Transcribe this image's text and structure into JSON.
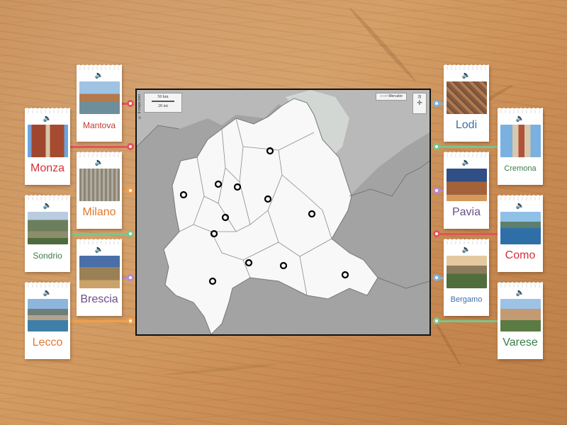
{
  "map": {
    "scale_km": "50 km",
    "scale_mi": "20 mi",
    "credit": "© d-maps.com",
    "projection": "Mercator",
    "north": "N"
  },
  "left_cards": [
    {
      "label": "Mantova",
      "color": "#c0392b",
      "connector": "#e0555a",
      "scene": "river-town"
    },
    {
      "label": "Monza",
      "color": "#d2323a",
      "connector": "#e0555a",
      "scene": "cathedral-square"
    },
    {
      "label": "Milano",
      "color": "#e07a2e",
      "connector": "#f0a04b",
      "scene": "gothic-cathedral"
    },
    {
      "label": "Sondrio",
      "color": "#3a7d48",
      "connector": "#7cc48d",
      "scene": "alpine-valley"
    },
    {
      "label": "Brescia",
      "color": "#6a4f8a",
      "connector": "#b48ad0",
      "scene": "church-domes"
    },
    {
      "label": "Lecco",
      "color": "#e07a2e",
      "connector": "#f0a04b",
      "scene": "lake-town"
    }
  ],
  "right_cards": [
    {
      "label": "Lodi",
      "color": "#3f6fa8",
      "connector": "#7fb2da",
      "scene": "aerial-town"
    },
    {
      "label": "Cremona",
      "color": "#3a7d48",
      "connector": "#7cc48d",
      "scene": "bell-tower"
    },
    {
      "label": "Pavia",
      "color": "#6a4f8a",
      "connector": "#b48ad0",
      "scene": "night-square"
    },
    {
      "label": "Como",
      "color": "#d2323a",
      "connector": "#e0555a",
      "scene": "lake-mountains"
    },
    {
      "label": "Bergamo",
      "color": "#3f6fa8",
      "connector": "#7fb2da",
      "scene": "hill-town"
    },
    {
      "label": "Varese",
      "color": "#3a7d48",
      "connector": "#7cc48d",
      "scene": "hilltop-village"
    }
  ],
  "icons": {
    "speaker": "speaker-icon"
  }
}
